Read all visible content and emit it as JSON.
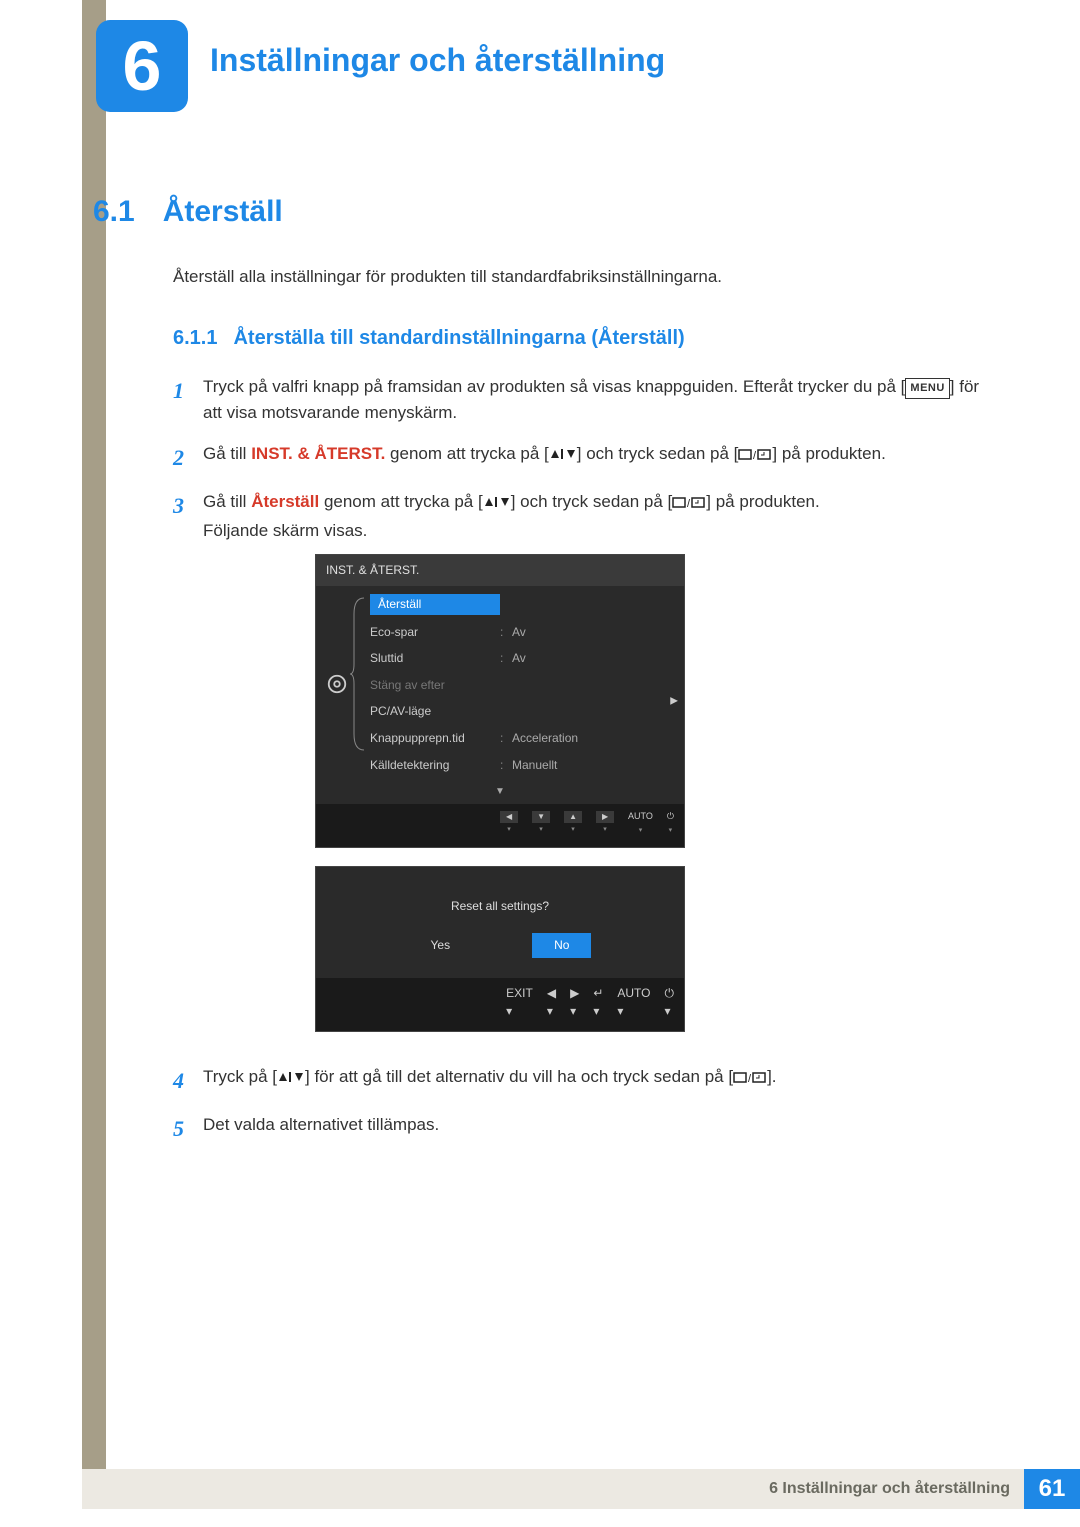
{
  "chapter": {
    "number": "6",
    "title": "Inställningar och återställning"
  },
  "section": {
    "number": "6.1",
    "title": "Återställ",
    "intro": "Återställ alla inställningar för produkten till standardfabriksinställningarna."
  },
  "subsection": {
    "number": "6.1.1",
    "title": "Återställa till standardinställningarna (Återställ)"
  },
  "steps": {
    "s1": {
      "num": "1",
      "a": "Tryck på valfri knapp på framsidan av produkten så visas knappguiden. Efteråt trycker du på [",
      "menu": "MENU",
      "b": "] för att visa motsvarande menyskärm."
    },
    "s2": {
      "num": "2",
      "a": "Gå till ",
      "bold": "INST. & ÅTERST.",
      "b": " genom att trycka på [",
      "c": "] och tryck sedan på [",
      "d": "] på produkten."
    },
    "s3": {
      "num": "3",
      "a": "Gå till ",
      "bold": "Återställ",
      "b": " genom att trycka på [",
      "c": "] och tryck sedan på [",
      "d": "] på produkten.",
      "after": "Följande skärm visas."
    },
    "s4": {
      "num": "4",
      "a": "Tryck på [",
      "b": "] för att gå till det alternativ du vill ha och tryck sedan på [",
      "c": "]."
    },
    "s5": {
      "num": "5",
      "text": "Det valda alternativet tillämpas."
    }
  },
  "osd1": {
    "header": "INST. & ÅTERST.",
    "rows": [
      {
        "label": "Återställ",
        "value": "",
        "selected": true
      },
      {
        "label": "Eco-spar",
        "value": "Av"
      },
      {
        "label": "Sluttid",
        "value": "Av"
      },
      {
        "label": "Stäng av efter",
        "value": "",
        "dim": true
      },
      {
        "label": "PC/AV-läge",
        "value": ""
      },
      {
        "label": "Knappupprepn.tid",
        "value": "Acceleration"
      },
      {
        "label": "Källdetektering",
        "value": "Manuellt"
      }
    ],
    "footer_auto": "AUTO"
  },
  "osd2": {
    "question": "Reset all settings?",
    "yes": "Yes",
    "no": "No",
    "exit": "EXIT",
    "auto": "AUTO"
  },
  "footer": {
    "text": "6 Inställningar och återställning",
    "page": "61"
  }
}
